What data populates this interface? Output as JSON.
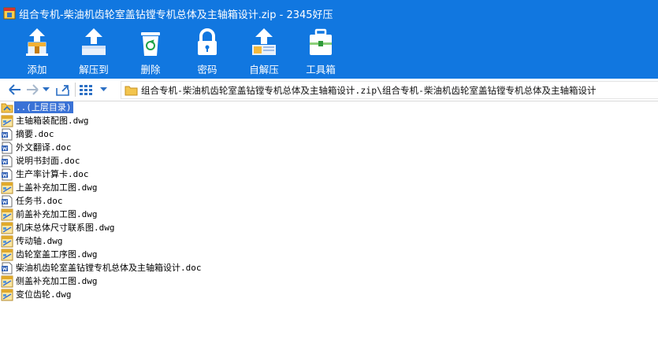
{
  "window": {
    "title": "组合专机-柴油机齿轮室盖钻镗专机总体及主轴箱设计.zip - 2345好压"
  },
  "toolbar": {
    "items": [
      {
        "label": "添加",
        "icon": "add-archive-icon"
      },
      {
        "label": "解压到",
        "icon": "extract-icon"
      },
      {
        "label": "删除",
        "icon": "recycle-bin-icon"
      },
      {
        "label": "密码",
        "icon": "lock-icon"
      },
      {
        "label": "自解压",
        "icon": "self-extract-icon"
      },
      {
        "label": "工具箱",
        "icon": "toolbox-icon"
      }
    ]
  },
  "addressbar": {
    "path": "组合专机-柴油机齿轮室盖钻镗专机总体及主轴箱设计.zip\\组合专机-柴油机齿轮室盖钻镗专机总体及主轴箱设计"
  },
  "files": [
    {
      "name": "..(上层目录)",
      "type": "parent"
    },
    {
      "name": "主轴箱装配图.dwg",
      "type": "dwg"
    },
    {
      "name": "摘要.doc",
      "type": "doc"
    },
    {
      "name": "外文翻译.doc",
      "type": "doc"
    },
    {
      "name": "说明书封面.doc",
      "type": "doc"
    },
    {
      "name": "生产率计算卡.doc",
      "type": "doc"
    },
    {
      "name": "上盖补充加工图.dwg",
      "type": "dwg"
    },
    {
      "name": "任务书.doc",
      "type": "doc"
    },
    {
      "name": "前盖补充加工图.dwg",
      "type": "dwg"
    },
    {
      "name": "机床总体尺寸联系图.dwg",
      "type": "dwg"
    },
    {
      "name": "传动轴.dwg",
      "type": "dwg"
    },
    {
      "name": "齿轮室盖工序图.dwg",
      "type": "dwg"
    },
    {
      "name": "柴油机齿轮室盖钻镗专机总体及主轴箱设计.doc",
      "type": "doc"
    },
    {
      "name": "侧盖补充加工图.dwg",
      "type": "dwg"
    },
    {
      "name": "变位齿轮.dwg",
      "type": "dwg"
    }
  ],
  "colors": {
    "accent": "#1177e0",
    "selection": "#3a72d6"
  }
}
